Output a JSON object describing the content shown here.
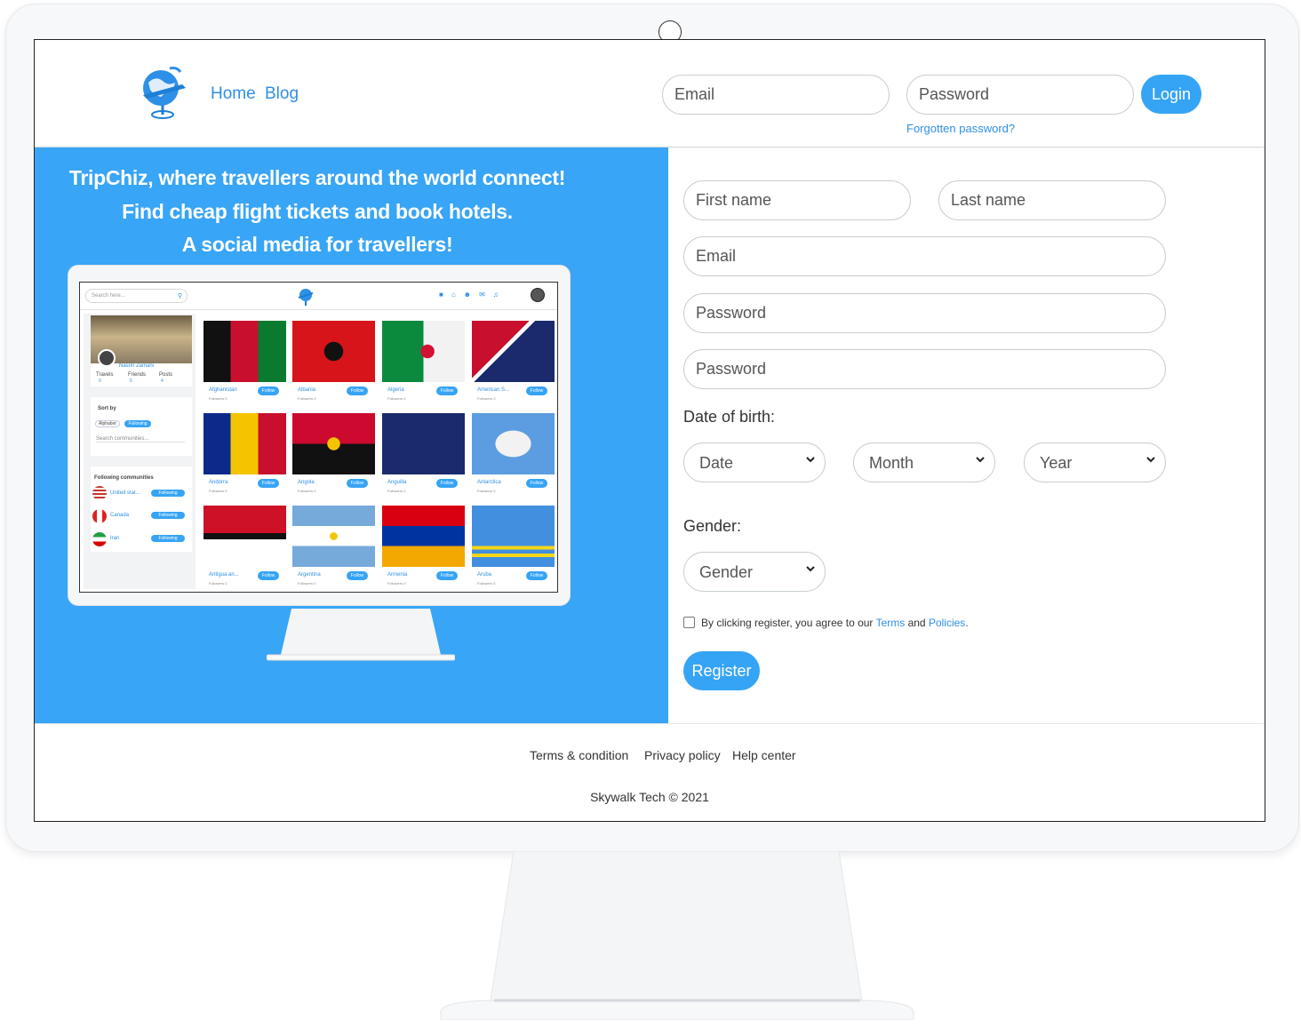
{
  "header": {
    "nav": [
      "Home",
      "Blog"
    ],
    "email_placeholder": "Email",
    "password_placeholder": "Password",
    "login_label": "Login",
    "forgot_label": "Forgotten password?"
  },
  "hero": {
    "taglines": [
      "TripChiz, where travellers around the world connect!",
      "Find cheap flight tickets and book hotels.",
      "A social media for travellers!"
    ],
    "mockup": {
      "search_placeholder": "Search here...",
      "profile": {
        "name": "Nasrin Zamani",
        "stats": [
          "Travels",
          "Friends",
          "Posts"
        ],
        "counts": [
          "0",
          "5",
          "4"
        ]
      },
      "sort_by": "Sort by",
      "sort_options": [
        "Alphabet",
        "Following"
      ],
      "search_communities": "Search communities...",
      "following_title": "Following communities",
      "following": [
        "United stat...",
        "Canada",
        "Iran"
      ],
      "following_label": "Following",
      "follow_label": "Follow",
      "countries": [
        "Afghanistan",
        "Albania",
        "Algeria",
        "American S...",
        "Andorra",
        "Angola",
        "Anguilla",
        "Antarctica",
        "Antigua an...",
        "Argentina",
        "Armenia",
        "Aruba"
      ],
      "followers": [
        "Followers 0",
        "Followers 0",
        "Followers 0",
        "Followers 0",
        "Followers 0",
        "Followers 0",
        "Followers 0",
        "Followers 0",
        "Followers 0",
        "Followers 0",
        "Followers 0",
        "Followers 0"
      ]
    }
  },
  "form": {
    "first_name": "First name",
    "last_name": "Last name",
    "email": "Email",
    "password": "Password",
    "password_confirm": "Password",
    "dob_label": "Date of birth:",
    "date": "Date",
    "month": "Month",
    "year": "Year",
    "gender_label": "Gender:",
    "gender": "Gender",
    "agree_prefix": "By clicking register, you agree to our",
    "terms": "Terms",
    "and": "and",
    "policies": "Policies",
    "period": ".",
    "register": "Register"
  },
  "footer": {
    "links": [
      "Terms & condition",
      "Privacy policy",
      "Help center"
    ],
    "copyright": "Skywalk Tech © 2021"
  },
  "colors": {
    "accent": "#36a4f5",
    "link": "#2e8fe6",
    "hero_bg": "#38a5f6"
  }
}
